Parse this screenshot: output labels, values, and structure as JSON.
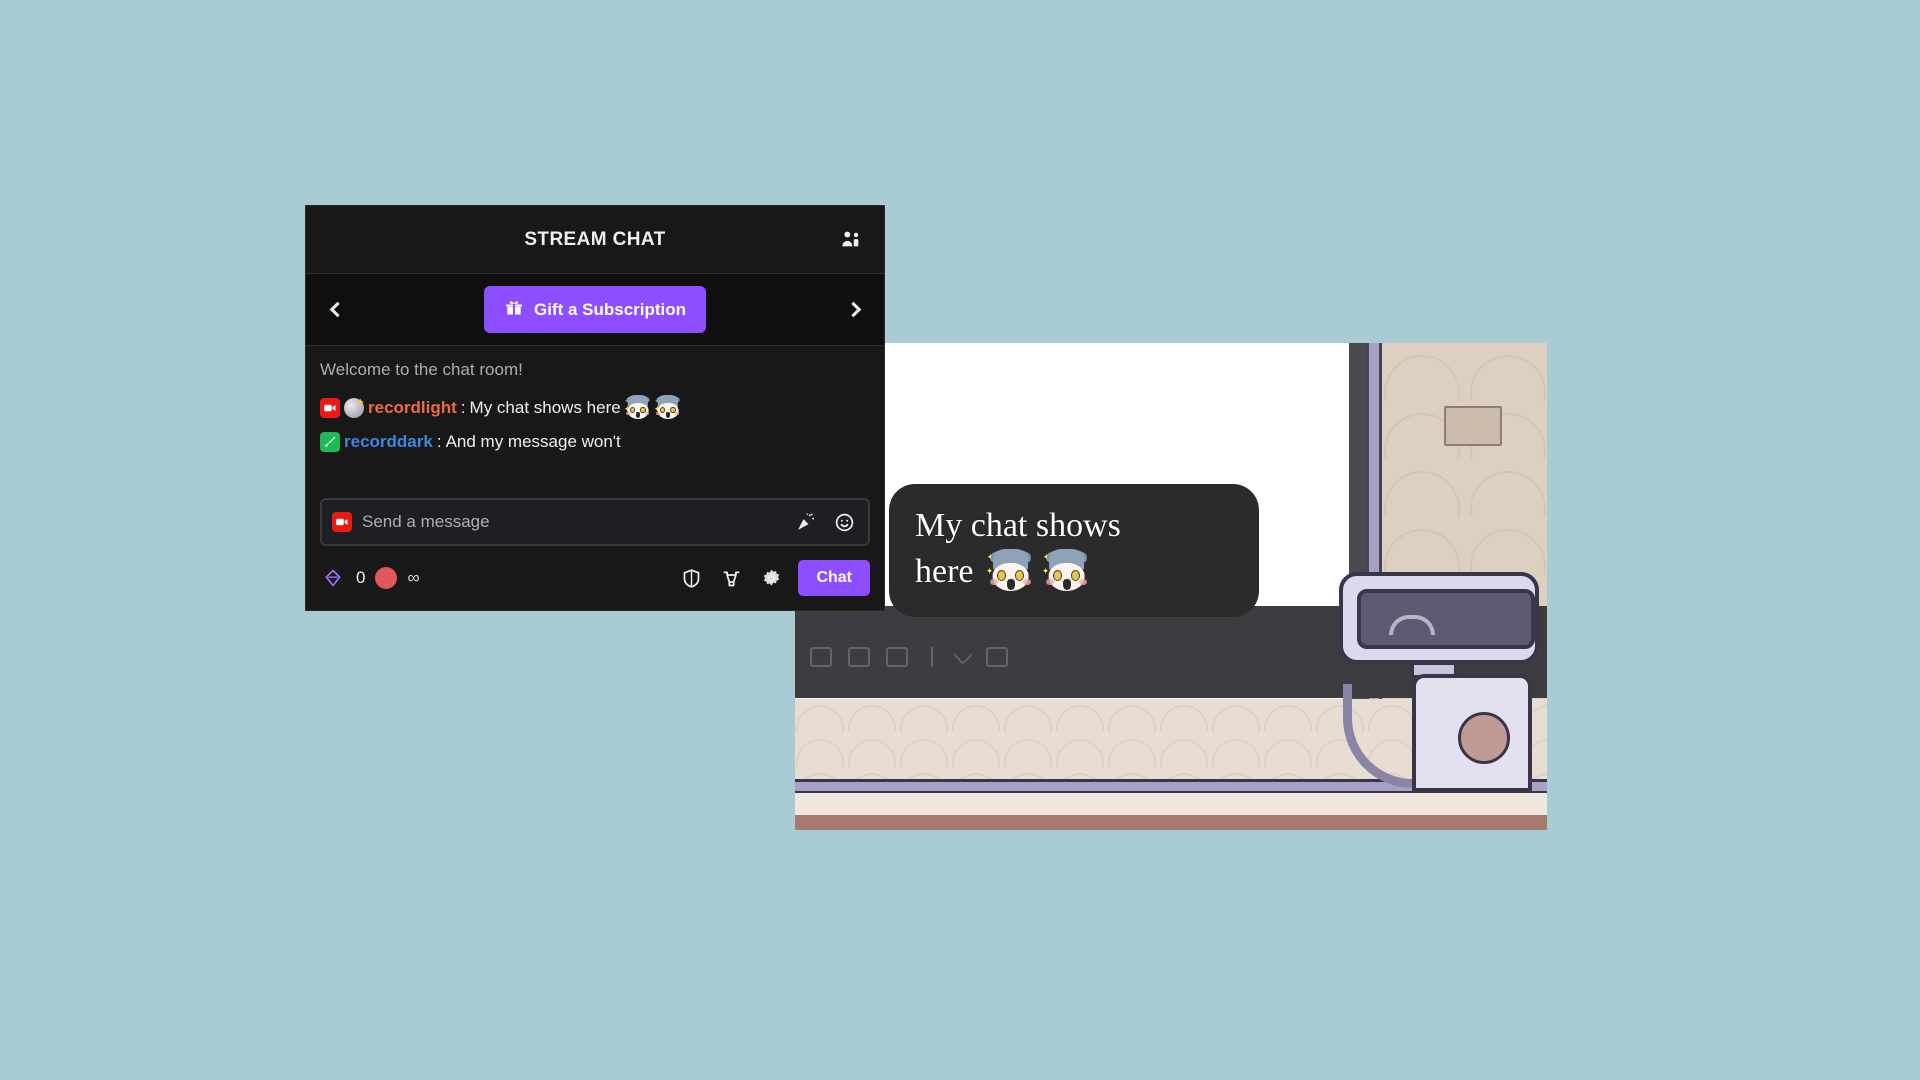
{
  "background_color": "#a9cbd4",
  "chat_panel": {
    "header": {
      "title": "STREAM CHAT",
      "community_icon": "community-users-icon"
    },
    "promo": {
      "prev_arrow": "chevron-left-icon",
      "next_arrow": "chevron-right-icon",
      "gift_icon": "gift-icon",
      "gift_label": "Gift a Subscription",
      "accent_color": "#8d4eff"
    },
    "messages": {
      "system_message": "Welcome to the chat room!",
      "items": [
        {
          "badges": [
            "broadcaster-camera-badge",
            "sparkle-orb-badge"
          ],
          "username": "recordlight",
          "username_color": "#ef6a43",
          "separator": ":",
          "text": "My chat shows here",
          "emotes": 2
        },
        {
          "badges": [
            "sword-badge"
          ],
          "username": "recorddark",
          "username_color": "#3e86e0",
          "separator": ":",
          "text": "And my message won't",
          "emotes": 0
        }
      ]
    },
    "input": {
      "prefix_icon": "camera-emote-icon",
      "placeholder": "Send a message",
      "value": "",
      "icons": [
        "confetti-icon",
        "emoji-smiley-icon"
      ]
    },
    "bottom_bar": {
      "gem_icon": "purple-gem-icon",
      "gem_count": "0",
      "circle_icon": "red-circle-icon",
      "infinity_symbol": "∞",
      "right_icons": [
        "shield-icon",
        "bits-icon",
        "gear-icon"
      ],
      "send_label": "Chat"
    }
  },
  "stream": {
    "overlay_bubble": {
      "line1": "My chat shows",
      "line2": "here",
      "emote_count": 2,
      "background": "#2b2b2b"
    },
    "scene": {
      "character": "cartoon-robot",
      "wall_color": "#ded0c0",
      "desk_color": "#3c3c41",
      "floor_color": "#e8ddd2"
    }
  }
}
